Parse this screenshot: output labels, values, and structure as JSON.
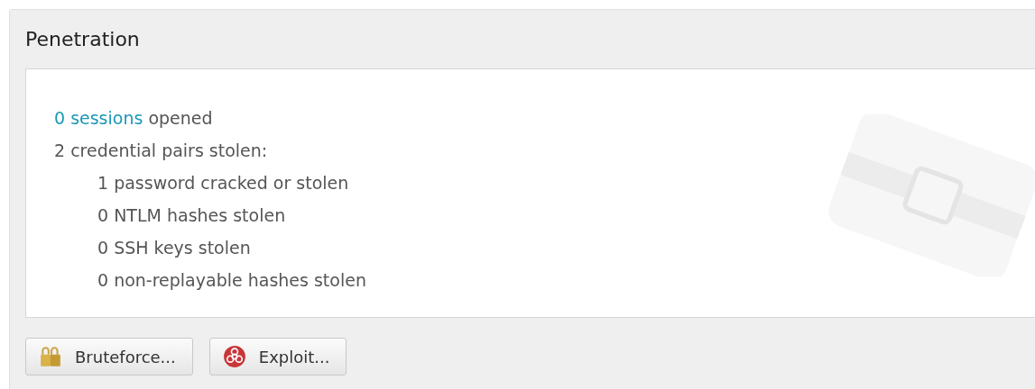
{
  "panel": {
    "title": "Penetration",
    "sessions": {
      "link": "0 sessions",
      "text": "opened"
    },
    "credentials": {
      "text": "2 credential pairs stolen:",
      "children": [
        {
          "text": "1 password cracked or stolen"
        },
        {
          "text": "0 NTLM hashes stolen"
        },
        {
          "text": "0 SSH keys stolen"
        },
        {
          "text": "0 non-replayable hashes stolen"
        }
      ]
    },
    "buttons": [
      {
        "label": "Bruteforce...",
        "kind": "bruteforce"
      },
      {
        "label": "Exploit...",
        "kind": "exploit"
      }
    ]
  }
}
